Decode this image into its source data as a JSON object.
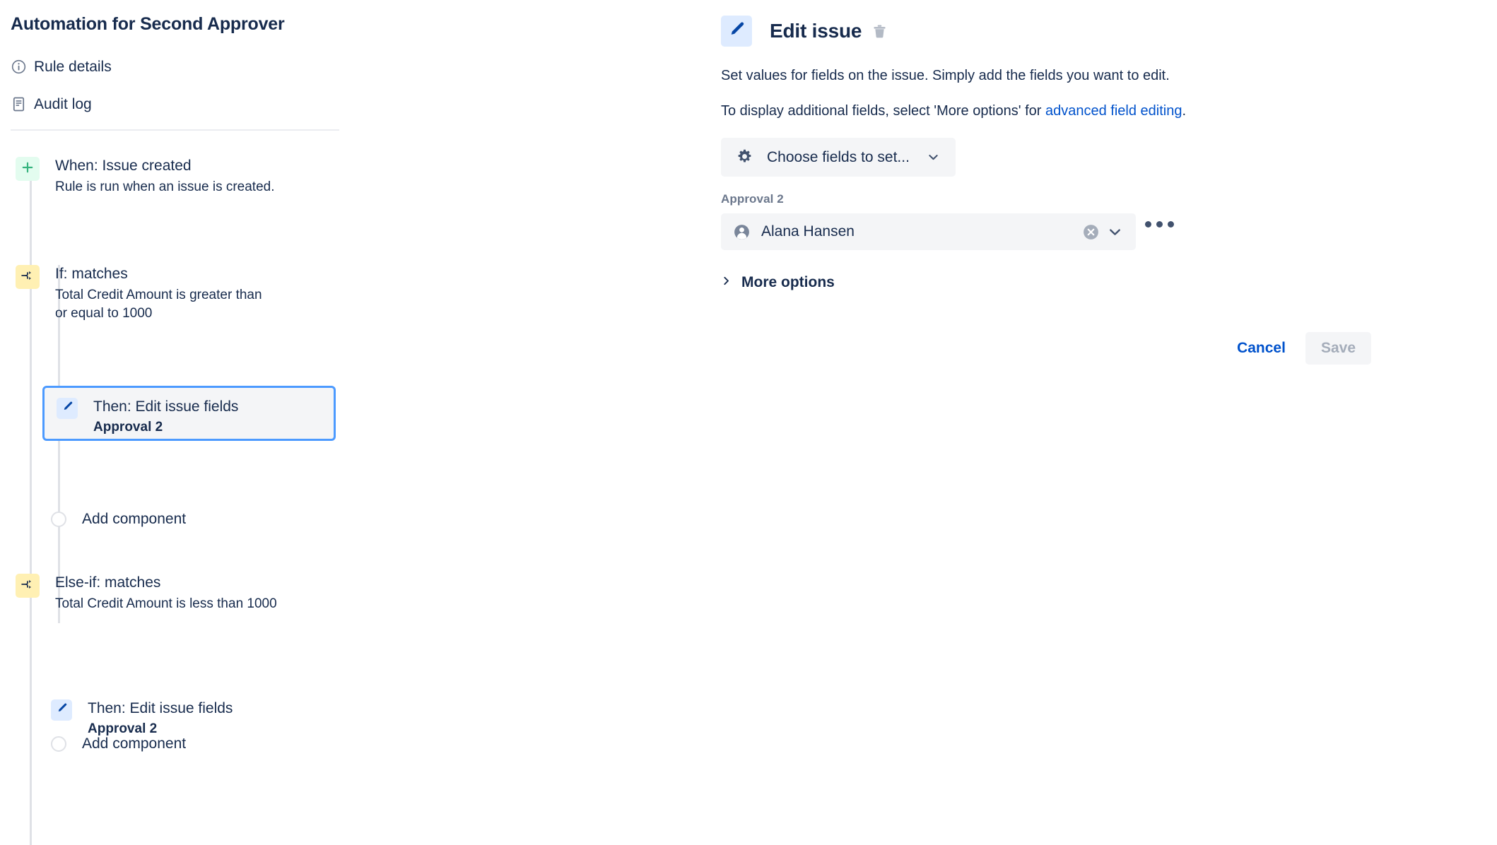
{
  "rule": {
    "title": "Automation for Second Approver",
    "nav": [
      {
        "label": "Rule details",
        "icon": "info-circle-icon"
      },
      {
        "label": "Audit log",
        "icon": "document-log-icon"
      }
    ],
    "nodes": [
      {
        "type": "trigger",
        "icon": "plus-icon",
        "title": "When: Issue created",
        "desc": "Rule is run when an issue is created."
      },
      {
        "type": "condition",
        "icon": "branch-icon",
        "title": "If: matches",
        "desc": "Total Credit Amount is greater than or equal to 1000"
      },
      {
        "type": "action",
        "icon": "pencil-icon",
        "title": "Then: Edit issue fields",
        "desc": "Approval 2",
        "selected": true
      },
      {
        "type": "add",
        "label": "Add component"
      },
      {
        "type": "condition",
        "icon": "branch-icon",
        "title": "Else-if: matches",
        "desc": "Total Credit Amount is less than 1000"
      },
      {
        "type": "action",
        "icon": "pencil-icon",
        "title": "Then: Edit issue fields",
        "desc": "Approval 2",
        "selected": false
      },
      {
        "type": "add",
        "label": "Add component"
      }
    ]
  },
  "detail": {
    "icon": "pencil-icon",
    "title": "Edit issue",
    "delete_icon": "trash-icon",
    "description_1": "Set values for fields on the issue. Simply add the fields you want to edit.",
    "description_2_prefix": "To display additional fields, select 'More options' for ",
    "description_2_link": "advanced field editing",
    "description_2_suffix": ".",
    "choose_fields": {
      "label": "Choose fields to set...",
      "icon": "gear-icon",
      "chevron": "chevron-down-icon"
    },
    "field": {
      "label": "Approval 2",
      "value": "Alana Hansen",
      "avatar_icon": "user-avatar-icon",
      "clear_icon": "clear-circle-icon",
      "chevron_icon": "chevron-down-icon",
      "more_icon": "more-ellipsis-icon"
    },
    "more_options": {
      "label": "More options",
      "icon": "chevron-right-icon"
    },
    "actions": {
      "cancel_label": "Cancel",
      "save_label": "Save"
    }
  },
  "colors": {
    "trigger_badge": "#E3FCEF",
    "condition_badge": "#FFF0B3",
    "action_badge": "#DEEBFF",
    "selected_border": "#4C9AFF",
    "link": "#0052CC",
    "text": "#172B4D",
    "subtle_text": "#6B778C"
  }
}
